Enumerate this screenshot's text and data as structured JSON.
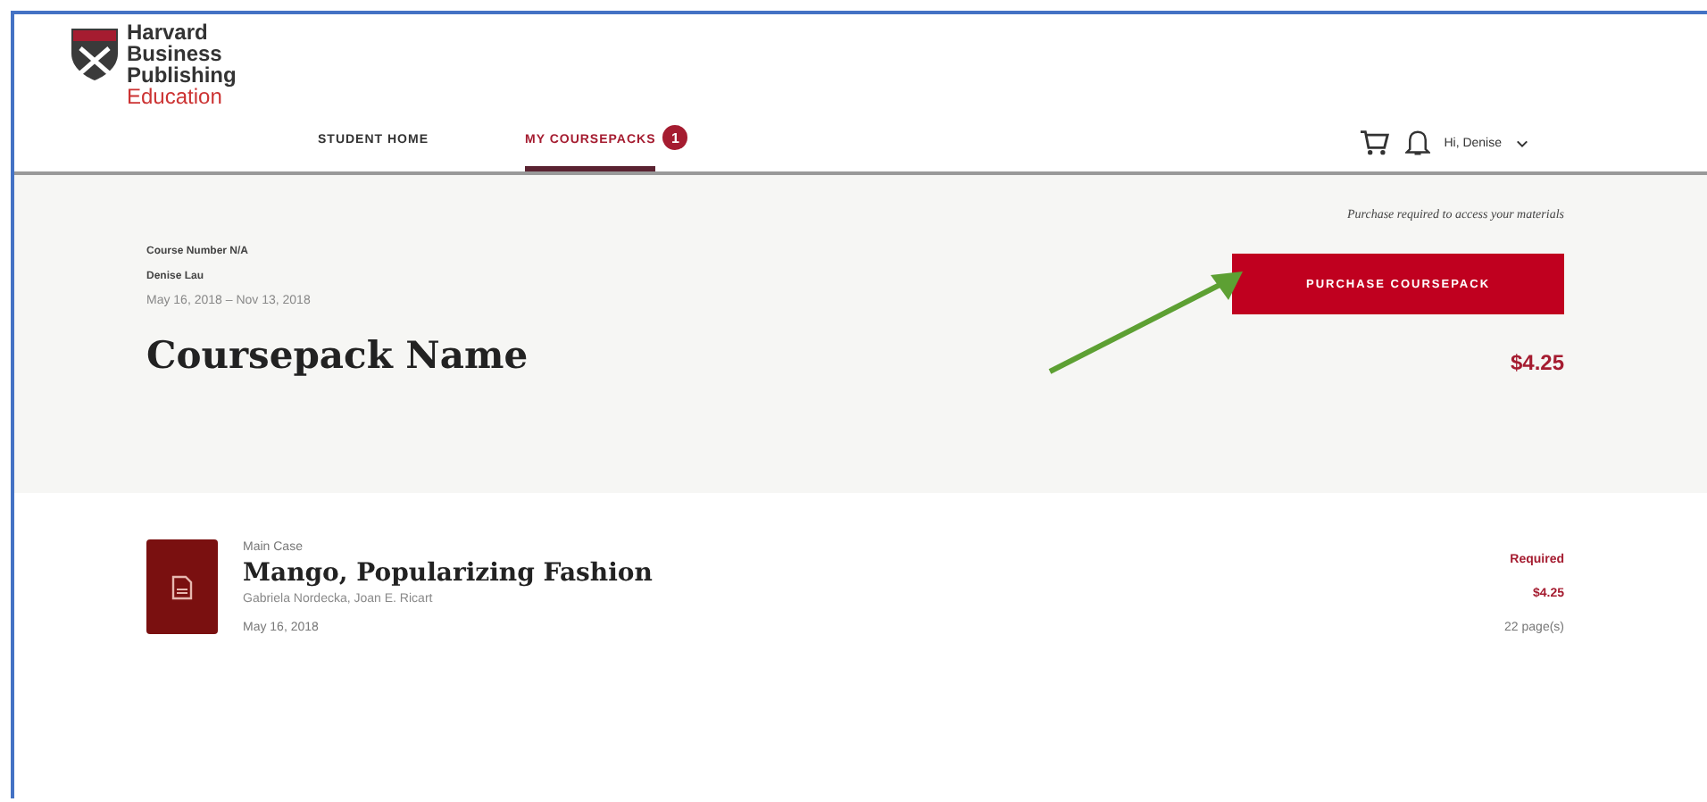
{
  "logo": {
    "lines": [
      "Harvard",
      "Business",
      "Publishing"
    ],
    "sub": "Education"
  },
  "tabs": [
    {
      "label": "STUDENT HOME",
      "selected": false
    },
    {
      "label": "MY COURSEPACKS",
      "selected": true,
      "badge": "1"
    }
  ],
  "user": {
    "greeting": "Hi, Denise"
  },
  "coursepack": {
    "course_number": "Course Number N/A",
    "instructor": "Denise Lau",
    "dates": "May 16, 2018 – Nov 13, 2018",
    "name": "Coursepack Name",
    "note": "Purchase required to access your materials",
    "button": "PURCHASE COURSEPACK",
    "price": "$4.25"
  },
  "items": [
    {
      "type": "Main Case",
      "title": "Mango, Popularizing Fashion",
      "authors": "Gabriela Nordecka, Joan E. Ricart",
      "date": "May 16, 2018",
      "status": "Required",
      "price": "$4.25",
      "pages": "22 page(s)"
    }
  ]
}
